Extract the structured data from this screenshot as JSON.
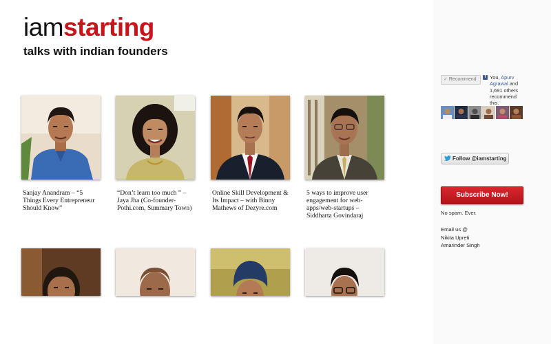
{
  "site": {
    "logo_light": "iam",
    "logo_bold": "starting",
    "tagline": "talks with indian founders",
    "accent": "#c8141b"
  },
  "posts": [
    {
      "caption": "Sanjay Anandram – “5 Things Every Entrepreneur Should Know”",
      "photo": "portrait-blue-shirt"
    },
    {
      "caption": "“Don’t learn too much ” – Jaya Jha (Co-founder-Pothi.com, Summary Town)",
      "photo": "portrait-woman"
    },
    {
      "caption": "Online Skill Development & Its Impact – with Binny Mathews of Dezyre.com",
      "photo": "portrait-suit-red-tie"
    },
    {
      "caption": "5 ways to improve user engagement for web-apps/web-startups – Siddharta Govindaraj",
      "photo": "portrait-glasses-suit"
    },
    {
      "caption": "",
      "photo": "portrait-smiling"
    },
    {
      "caption": "",
      "photo": "portrait-bald"
    },
    {
      "caption": "",
      "photo": "portrait-turban"
    },
    {
      "caption": "",
      "photo": "portrait-glasses"
    }
  ],
  "facebook": {
    "recommend_label": "Recommend",
    "prefix": "You, ",
    "friend": "Apurv Agrawal",
    "suffix": " and 1,691 others recommend this.",
    "brand_color": "#3b5998"
  },
  "twitter": {
    "follow_label": "Follow @iamstarting"
  },
  "subscribe": {
    "label": "Subscribe Now!",
    "note": "No spam. Ever."
  },
  "contact": {
    "label": "Email us @",
    "names": [
      "Nikita Upreti",
      "Amarinder Singh"
    ]
  }
}
